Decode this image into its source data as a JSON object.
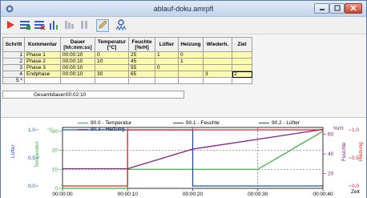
{
  "window": {
    "title": "ablauf-doku.amrpfl"
  },
  "toolbar": {
    "icons": [
      "play-icon",
      "insert-rows-icon",
      "delete-rows-icon",
      "chart-icon",
      "table-icon",
      "pause-icon",
      "edit-icon",
      "users-icon"
    ]
  },
  "table": {
    "headers": [
      "Schritt",
      "Kommentar",
      "Dauer [hh:mm:ss]",
      "Temperatur [°C]",
      "Feuchte [%rH]",
      "Lüfter",
      "Heizung",
      "Wiederh.",
      "Ziel"
    ],
    "rows": [
      {
        "num": "1",
        "comment": "Phase 1",
        "duration": "00:00:10",
        "temp": "0",
        "humidity": "25",
        "fan": "1",
        "heating": "0",
        "repeat": "",
        "target": ""
      },
      {
        "num": "2",
        "comment": "Phase 2",
        "duration": "00:00:10",
        "temp": "10",
        "humidity": "45",
        "fan": "",
        "heating": "1",
        "repeat": "",
        "target": ""
      },
      {
        "num": "3",
        "comment": "Phase 3",
        "duration": "00:00:10",
        "temp": "",
        "humidity": "55",
        "fan": "0",
        "heating": "",
        "repeat": "",
        "target": ""
      },
      {
        "num": "4",
        "comment": "Endphase",
        "duration": "00:00:10",
        "temp": "30",
        "humidity": "65",
        "fan": "",
        "heating": "",
        "repeat": "3",
        "target": "2"
      },
      {
        "num": "5 *",
        "comment": "",
        "duration": "",
        "temp": "",
        "humidity": "",
        "fan": "",
        "heating": "",
        "repeat": "",
        "target": ""
      }
    ],
    "total_label": "Gesamtdauer:",
    "total_value": "00:02:10"
  },
  "chart_data": {
    "type": "line",
    "legend": [
      {
        "name": "90.0 - Temperatur",
        "color": "#3cb043"
      },
      {
        "name": "90.1 - Feuchte",
        "color": "#8b1a8b"
      },
      {
        "name": "90.2 - Lüfter",
        "color": "#1f4fb5"
      },
      {
        "name": "90.3 - Heizung",
        "color": "#e02020"
      }
    ],
    "x_ticks": [
      "00:00:00",
      "00:00:10",
      "00:00:20",
      "00:00:30",
      "00:00:40"
    ],
    "x_label": "Zeit",
    "left_axis_1": {
      "label": "Lüfter",
      "ticks": [
        "1.0",
        "0.5",
        "0.0"
      ],
      "color": "#1f4fb5"
    },
    "left_axis_2": {
      "label": "Temperatur",
      "unit": "°C",
      "ticks": [
        "30",
        "20",
        "10",
        "0"
      ],
      "color": "#3cb043"
    },
    "right_axis_1": {
      "label": "Feuchte",
      "unit": "%rH",
      "ticks": [
        "60",
        "40",
        "20"
      ],
      "color": "#8b1a8b"
    },
    "right_axis_2": {
      "label": "Heizung",
      "ticks": [
        "1.0",
        "0.5",
        "0.0"
      ],
      "color": "#e02020"
    },
    "series": [
      {
        "name": "90.0 - Temperatur",
        "x": [
          0,
          10,
          10,
          20,
          30,
          40
        ],
        "y": [
          0,
          0,
          10,
          10,
          10,
          30
        ]
      },
      {
        "name": "90.1 - Feuchte",
        "x": [
          0,
          10,
          20,
          30,
          40
        ],
        "y": [
          25,
          25,
          45,
          55,
          65
        ]
      },
      {
        "name": "90.2 - Lüfter",
        "x": [
          0,
          10,
          10,
          20,
          20,
          40
        ],
        "y": [
          1,
          1,
          1,
          1,
          0,
          0
        ]
      },
      {
        "name": "90.3 - Heizung",
        "x": [
          0,
          10,
          10,
          40
        ],
        "y": [
          0,
          0,
          1,
          1
        ]
      }
    ]
  }
}
